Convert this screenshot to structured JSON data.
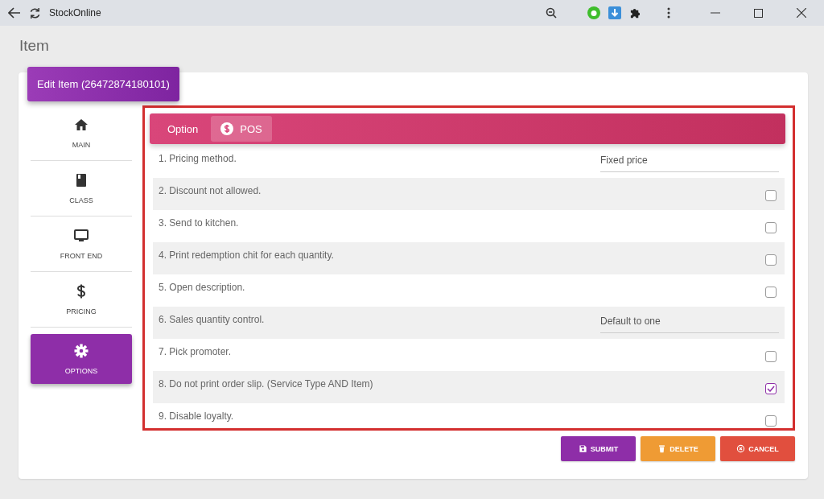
{
  "browser": {
    "title": "StockOnline"
  },
  "page": {
    "title": "Item"
  },
  "badge": "Edit Item (26472874180101)",
  "sidebar": {
    "items": [
      {
        "label": "MAIN",
        "kind": "home",
        "selected": false
      },
      {
        "label": "CLASS",
        "kind": "book",
        "selected": false
      },
      {
        "label": "FRONT END",
        "kind": "monitor",
        "selected": false
      },
      {
        "label": "PRICING",
        "kind": "dollar",
        "selected": false
      },
      {
        "label": "OPTIONS",
        "kind": "gear",
        "selected": true
      }
    ]
  },
  "tabs": [
    {
      "label": "Option",
      "selected": false
    },
    {
      "label": "POS",
      "selected": true
    }
  ],
  "options": [
    {
      "kind": "select",
      "label": "1. Pricing method.",
      "value": "Fixed price"
    },
    {
      "kind": "checkbox",
      "label": "2. Discount not allowed.",
      "checked": false
    },
    {
      "kind": "checkbox",
      "label": "3. Send to kitchen.",
      "checked": false
    },
    {
      "kind": "checkbox",
      "label": "4. Print redemption chit for each quantity.",
      "checked": false
    },
    {
      "kind": "checkbox",
      "label": "5. Open description.",
      "checked": false
    },
    {
      "kind": "select",
      "label": "6. Sales quantity control.",
      "value": "Default to one"
    },
    {
      "kind": "checkbox",
      "label": "7. Pick promoter.",
      "checked": false
    },
    {
      "kind": "checkbox",
      "label": "8. Do not print order slip. (Service Type AND Item)",
      "checked": true
    },
    {
      "kind": "checkbox",
      "label": "9. Disable loyalty.",
      "checked": false
    }
  ],
  "buttons": [
    {
      "kind": "submit",
      "label": "SUBMIT"
    },
    {
      "kind": "delete",
      "label": "DELETE"
    },
    {
      "kind": "cancel",
      "label": "CANCEL"
    }
  ]
}
